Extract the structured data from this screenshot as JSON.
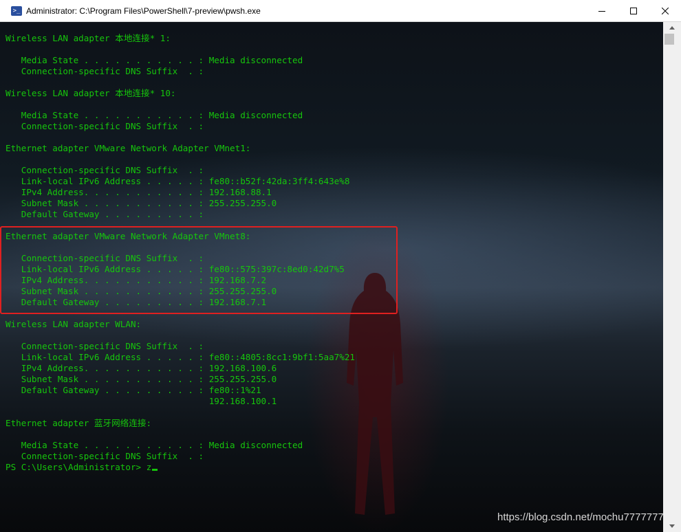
{
  "window": {
    "title": "Administrator: C:\\Program Files\\PowerShell\\7-preview\\pwsh.exe",
    "app_icon": "powershell-icon",
    "controls": [
      "minimize-icon",
      "maximize-icon",
      "close-icon"
    ]
  },
  "terminal": {
    "text_color": "#16c60c",
    "lines": [
      "Wireless LAN adapter 本地连接* 1:",
      "",
      "   Media State . . . . . . . . . . . : Media disconnected",
      "   Connection-specific DNS Suffix  . :",
      "",
      "Wireless LAN adapter 本地连接* 10:",
      "",
      "   Media State . . . . . . . . . . . : Media disconnected",
      "   Connection-specific DNS Suffix  . :",
      "",
      "Ethernet adapter VMware Network Adapter VMnet1:",
      "",
      "   Connection-specific DNS Suffix  . :",
      "   Link-local IPv6 Address . . . . . : fe80::b52f:42da:3ff4:643e%8",
      "   IPv4 Address. . . . . . . . . . . : 192.168.88.1",
      "   Subnet Mask . . . . . . . . . . . : 255.255.255.0",
      "   Default Gateway . . . . . . . . . :",
      "",
      "Ethernet adapter VMware Network Adapter VMnet8:",
      "",
      "   Connection-specific DNS Suffix  . :",
      "   Link-local IPv6 Address . . . . . : fe80::575:397c:8ed0:42d7%5",
      "   IPv4 Address. . . . . . . . . . . : 192.168.7.2",
      "   Subnet Mask . . . . . . . . . . . : 255.255.255.0",
      "   Default Gateway . . . . . . . . . : 192.168.7.1",
      "",
      "Wireless LAN adapter WLAN:",
      "",
      "   Connection-specific DNS Suffix  . :",
      "   Link-local IPv6 Address . . . . . : fe80::4805:8cc1:9bf1:5aa7%21",
      "   IPv4 Address. . . . . . . . . . . : 192.168.100.6",
      "   Subnet Mask . . . . . . . . . . . : 255.255.255.0",
      "   Default Gateway . . . . . . . . . : fe80::1%21",
      "                                       192.168.100.1",
      "",
      "Ethernet adapter 蓝牙网络连接:",
      "",
      "   Media State . . . . . . . . . . . : Media disconnected",
      "   Connection-specific DNS Suffix  . :"
    ],
    "prompt": "PS C:\\Users\\Administrator> ",
    "input": "z",
    "highlight_color": "#e02020"
  },
  "watermark": "https://blog.csdn.net/mochu7777777"
}
